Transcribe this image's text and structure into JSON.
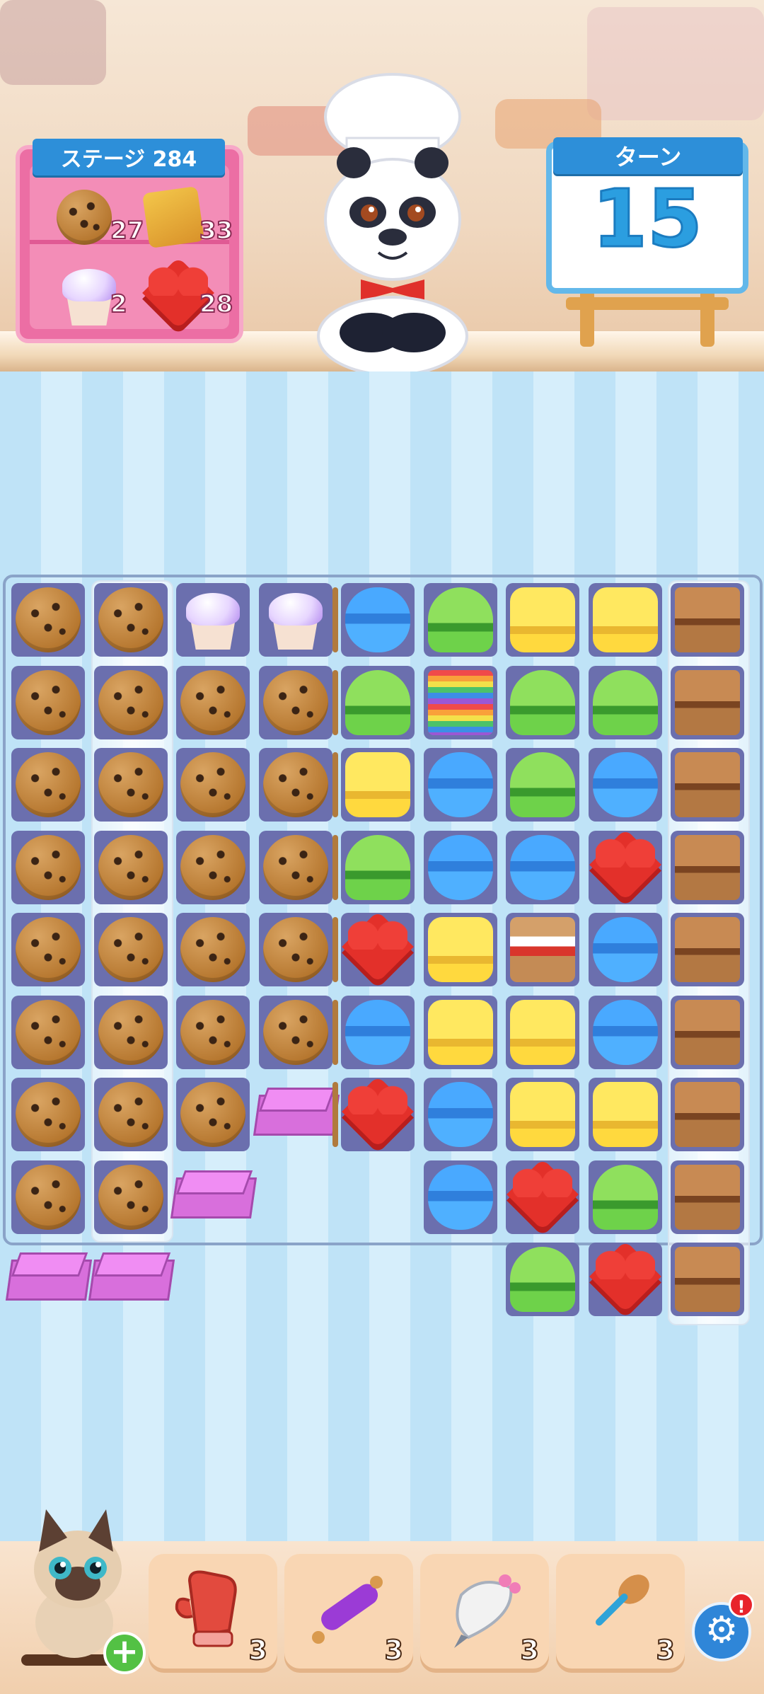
{
  "header": {
    "stage_label": "ステージ 284",
    "turn_label": "ターン",
    "turns_left": "15"
  },
  "goals": [
    {
      "icon": "cookie-icon",
      "count": "27"
    },
    {
      "icon": "cheese-toast-icon",
      "count": "33"
    },
    {
      "icon": "cupcake-icon",
      "count": "2"
    },
    {
      "icon": "heart-candy-icon",
      "count": "28"
    }
  ],
  "board": {
    "columns": 9,
    "rows": 9,
    "tiles": [
      [
        "cookie",
        "cookie",
        "cupcake",
        "cupcake",
        "macaron-blue",
        "macaron-green",
        "macaron-yellow",
        "macaron-yellow",
        "brownie"
      ],
      [
        "cookie",
        "cookie",
        "cookie",
        "cookie",
        "macaron-green",
        "cake",
        "macaron-green",
        "macaron-green",
        "brownie"
      ],
      [
        "cookie",
        "cookie",
        "cookie",
        "cookie",
        "macaron-yellow",
        "macaron-blue",
        "macaron-green",
        "macaron-blue",
        "brownie"
      ],
      [
        "cookie",
        "cookie",
        "cookie",
        "cookie",
        "macaron-green",
        "macaron-blue",
        "macaron-blue",
        "heart",
        "brownie"
      ],
      [
        "cookie",
        "cookie",
        "cookie",
        "cookie",
        "heart",
        "macaron-yellow",
        "smores",
        "macaron-blue",
        "brownie"
      ],
      [
        "cookie",
        "cookie",
        "cookie",
        "cookie",
        "macaron-blue",
        "macaron-yellow",
        "macaron-yellow",
        "macaron-blue",
        "brownie"
      ],
      [
        "cookie",
        "cookie",
        "cookie",
        "box",
        "heart",
        "macaron-blue",
        "macaron-yellow",
        "macaron-yellow",
        "brownie"
      ],
      [
        "cookie",
        "cookie",
        "box",
        "",
        "",
        "macaron-blue",
        "heart",
        "macaron-green",
        "brownie"
      ],
      [
        "box",
        "box",
        "",
        "",
        "",
        "",
        "macaron-green",
        "heart",
        "brownie"
      ]
    ]
  },
  "boosters": [
    {
      "name": "oven-mitt-booster",
      "icon": "oven-mitt-icon",
      "count": "3"
    },
    {
      "name": "rolling-pin-booster",
      "icon": "rolling-pin-icon",
      "count": "3"
    },
    {
      "name": "piping-bag-booster",
      "icon": "piping-bag-icon",
      "count": "3"
    },
    {
      "name": "spoon-booster",
      "icon": "wooden-spoon-icon",
      "count": "3"
    }
  ],
  "settings": {
    "icon": "gear-icon",
    "badge": "!"
  },
  "colors": {
    "banner": "#2d8fd9",
    "goal_board": "#ec6ea4",
    "turn_number": "#2b9ee0",
    "booster_bg": "#f9d6b3"
  }
}
